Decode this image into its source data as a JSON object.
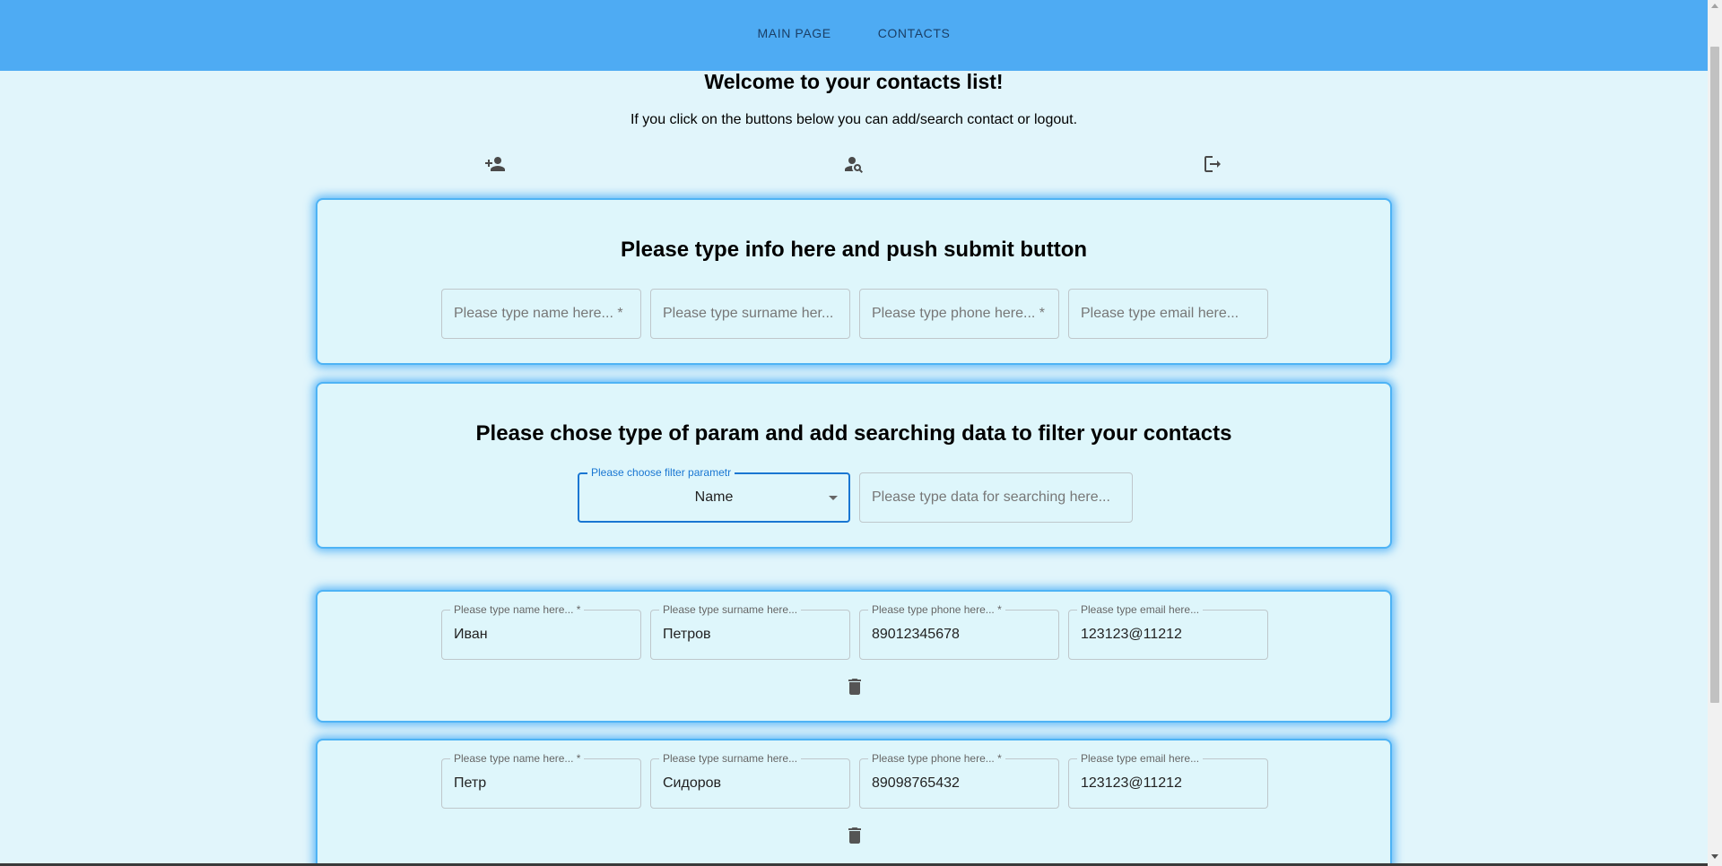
{
  "nav": {
    "main_page": "MAIN PAGE",
    "contacts": "CONTACTS"
  },
  "header": {
    "title": "Welcome to your contacts list!",
    "subtitle": "If you click on the buttons below you can add/search contact or logout."
  },
  "actions": {
    "add_icon": "person-add-icon",
    "search_icon": "person-search-icon",
    "logout_icon": "logout-icon"
  },
  "add_form": {
    "title": "Please type info here and push submit button",
    "name_placeholder": "Please type name here... *",
    "surname_placeholder": "Please type surname her...",
    "phone_placeholder": "Please type phone here... *",
    "email_placeholder": "Please type email here..."
  },
  "filter_form": {
    "title": "Please chose type of param and add searching data to filter your contacts",
    "select_label": "Please choose filter parametr",
    "select_value": "Name",
    "search_placeholder": "Please type data for searching here..."
  },
  "contacts": [
    {
      "name_label": "Please type name here... *",
      "name": "Иван",
      "surname_label": "Please type surname here...",
      "surname": "Петров",
      "phone_label": "Please type phone here... *",
      "phone": "89012345678",
      "email_label": "Please type email here...",
      "email": "123123@11212"
    },
    {
      "name_label": "Please type name here... *",
      "name": "Петр",
      "surname_label": "Please type surname here...",
      "surname": "Сидоров",
      "phone_label": "Please type phone here... *",
      "phone": "89098765432",
      "email_label": "Please type email here...",
      "email": "123123@11212"
    }
  ],
  "colors": {
    "topbar": "#4eabf3",
    "background": "#e1f5fb",
    "card_border": "#4eb3f5",
    "focus": "#1976d2"
  }
}
